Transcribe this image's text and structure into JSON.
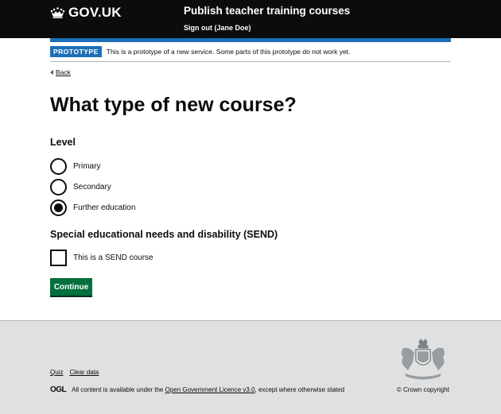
{
  "header": {
    "logo_text": "GOV.UK",
    "logo_icon": "crown-icon",
    "service_name": "Publish teacher training courses",
    "signout_label": "Sign out (Jane Doe)"
  },
  "phase_banner": {
    "tag": "PROTOTYPE",
    "text": "This is a prototype of a new service. Some parts of this prototype do not work yet."
  },
  "back_link": "Back",
  "page_title": "What type of new course?",
  "level": {
    "legend": "Level",
    "options": [
      {
        "label": "Primary",
        "selected": false
      },
      {
        "label": "Secondary",
        "selected": false
      },
      {
        "label": "Further education",
        "selected": true
      }
    ]
  },
  "send": {
    "legend": "Special educational needs and disability (SEND)",
    "checkbox_label": "This is a SEND course",
    "checked": false
  },
  "continue_label": "Continue",
  "footer": {
    "links": [
      "Quiz",
      "Clear data"
    ],
    "ogl_icon": "OGL",
    "licence_prefix": "All content is available under the",
    "licence_link": "Open Government Licence v3.0",
    "licence_suffix": ", except where otherwise stated",
    "copyright": "© Crown copyright"
  },
  "colors": {
    "header_bg": "#0b0c0c",
    "accent_blue": "#1d70b8",
    "button_green": "#00703c",
    "footer_bg": "#dfe0e1"
  }
}
